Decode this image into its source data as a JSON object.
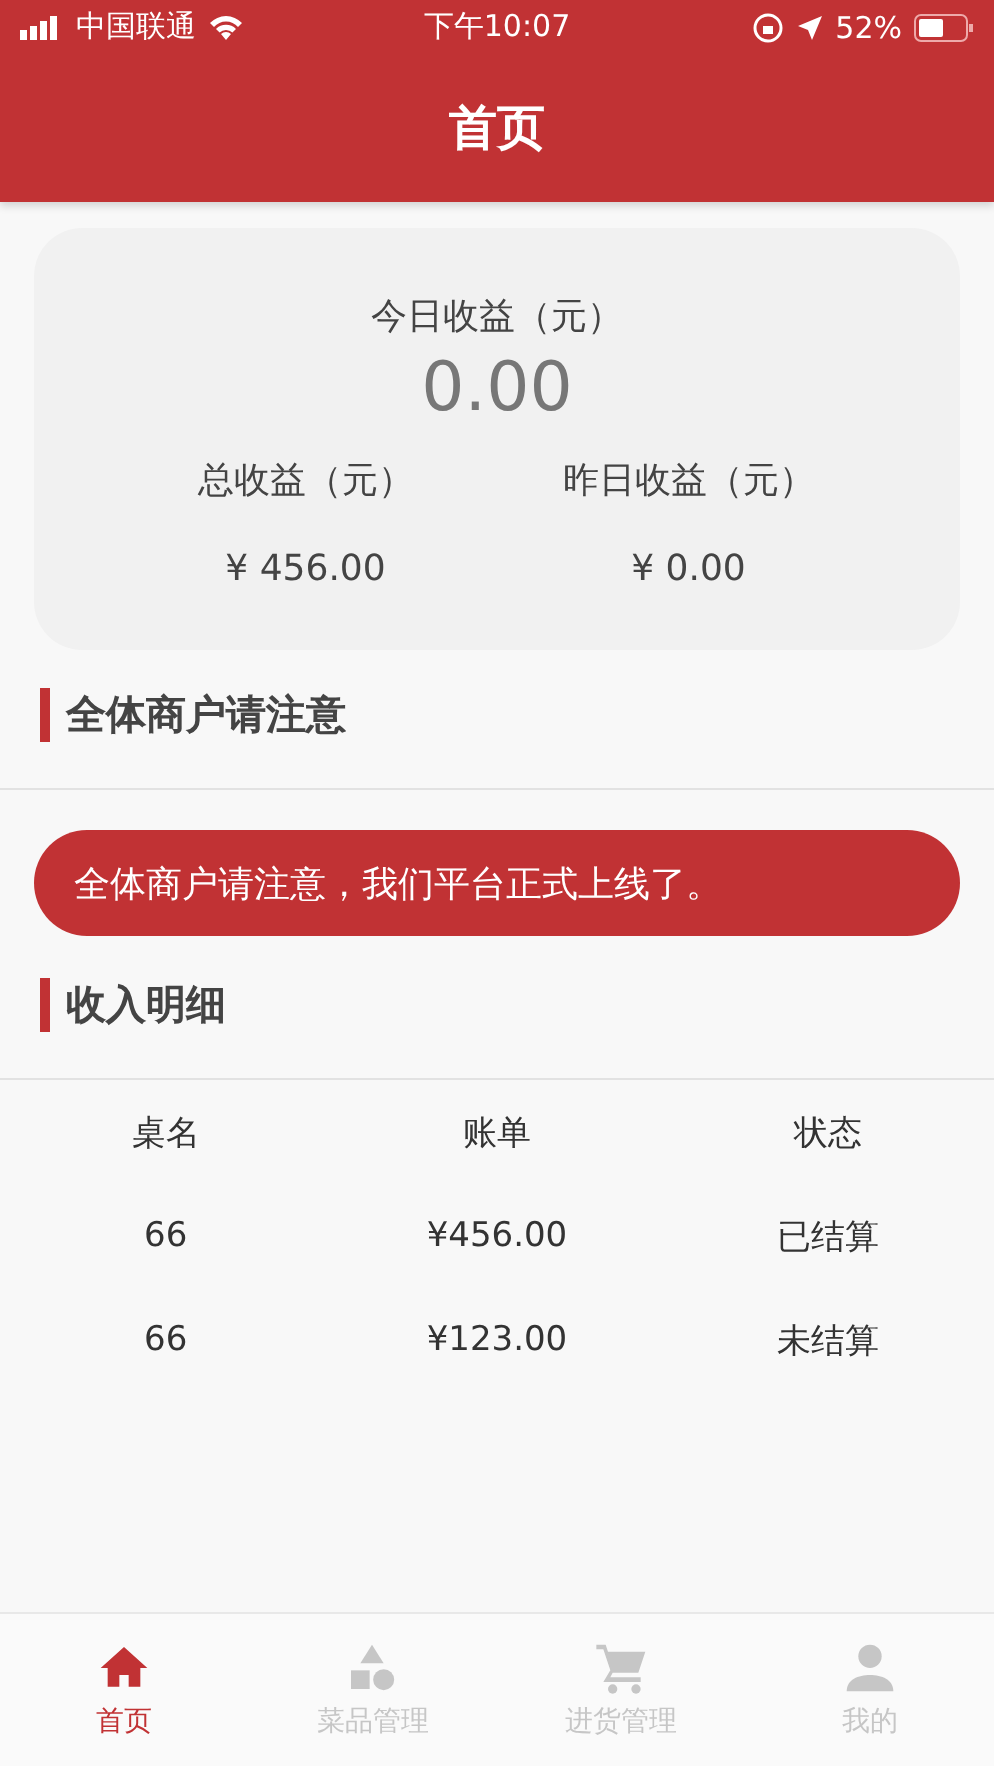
{
  "status_bar": {
    "carrier": "中国联通",
    "time": "下午10:07",
    "battery": "52%"
  },
  "header": {
    "title": "首页"
  },
  "summary": {
    "today_label": "今日收益（元）",
    "today_value": "0.00",
    "stats": [
      {
        "label": "总收益（元）",
        "value": "¥ 456.00"
      },
      {
        "label": "昨日收益（元）",
        "value": "¥ 0.00"
      }
    ]
  },
  "notice_section": {
    "title": "全体商户请注意",
    "message": "全体商户请注意，我们平台正式上线了。"
  },
  "income_section": {
    "title": "收入明细",
    "columns": [
      "桌名",
      "账单",
      "状态"
    ],
    "rows": [
      [
        "66",
        "¥456.00",
        "已结算"
      ],
      [
        "66",
        "¥123.00",
        "未结算"
      ]
    ]
  },
  "tab_bar": [
    {
      "label": "首页",
      "selected": true
    },
    {
      "label": "菜品管理",
      "selected": false
    },
    {
      "label": "进货管理",
      "selected": false
    },
    {
      "label": "我的",
      "selected": false
    }
  ]
}
